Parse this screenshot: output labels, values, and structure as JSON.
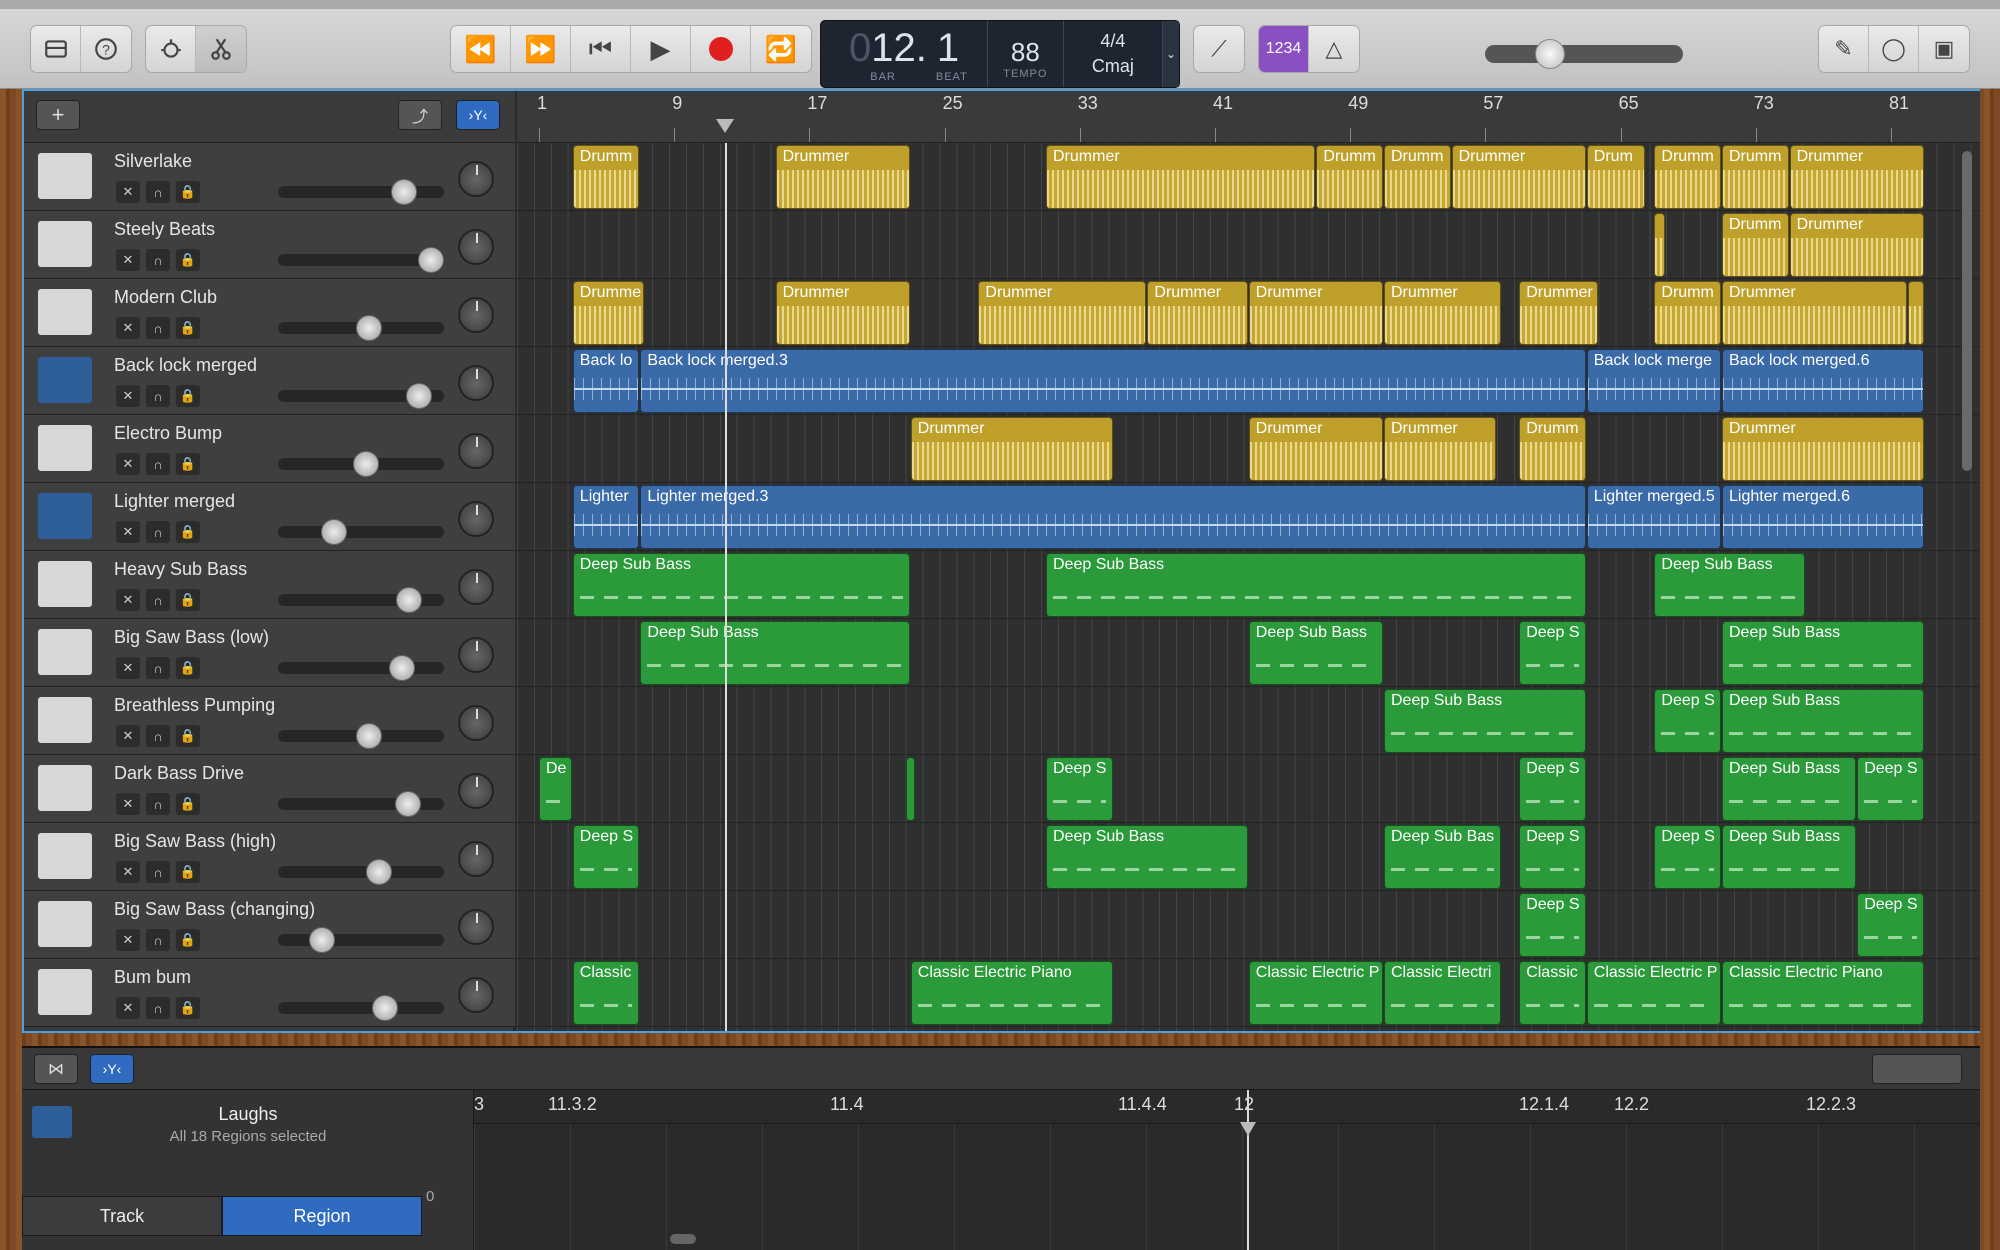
{
  "toolbar": {
    "lcd": {
      "bar": "12.",
      "beat": "1",
      "bar_label": "BAR",
      "beat_label": "BEAT",
      "tempo": "88",
      "tempo_label": "TEMPO",
      "signature": "4/4",
      "key": "Cmaj",
      "lead": "0"
    },
    "count_in_label": "1234",
    "colors": {
      "accent": "#8a4fc0",
      "record": "#e02020"
    }
  },
  "ruler": {
    "bars": [
      "1",
      "9",
      "17",
      "25",
      "33",
      "41",
      "49",
      "57",
      "65",
      "73",
      "81"
    ]
  },
  "tracks": [
    {
      "name": "Silverlake",
      "icon": "drum-machine-icon"
    },
    {
      "name": "Steely Beats",
      "icon": "drum-machine-icon"
    },
    {
      "name": "Modern Club",
      "icon": "drum-machine-icon"
    },
    {
      "name": "Back lock merged",
      "icon": "waveform-icon"
    },
    {
      "name": "Electro Bump",
      "icon": "drum-machine-icon"
    },
    {
      "name": "Lighter merged",
      "icon": "waveform-icon"
    },
    {
      "name": "Heavy Sub Bass",
      "icon": "keyboard-stand-icon"
    },
    {
      "name": "Big Saw Bass (low)",
      "icon": "synth-icon"
    },
    {
      "name": "Breathless Pumping",
      "icon": "keyboard-stand-icon"
    },
    {
      "name": "Dark Bass Drive",
      "icon": "keyboard-stand-icon"
    },
    {
      "name": "Big Saw Bass (high)",
      "icon": "synth-icon"
    },
    {
      "name": "Big Saw Bass (changing)",
      "icon": "synth-icon"
    },
    {
      "name": "Bum bum",
      "icon": "keyboard-stand-icon"
    }
  ],
  "regions": [
    [
      {
        "t": "drum",
        "s": 3,
        "e": 7,
        "l": "Drumm"
      },
      {
        "t": "drum",
        "s": 15,
        "e": 23,
        "l": "Drummer"
      },
      {
        "t": "drum",
        "s": 31,
        "e": 47,
        "l": "Drummer"
      },
      {
        "t": "drum",
        "s": 47,
        "e": 51,
        "l": "Drumm"
      },
      {
        "t": "drum",
        "s": 51,
        "e": 55,
        "l": "Drumm"
      },
      {
        "t": "drum",
        "s": 55,
        "e": 63,
        "l": "Drummer"
      },
      {
        "t": "drum",
        "s": 63,
        "e": 66.5,
        "l": "Drum"
      },
      {
        "t": "drum",
        "s": 67,
        "e": 71,
        "l": "Drumm"
      },
      {
        "t": "drum",
        "s": 71,
        "e": 75,
        "l": "Drumm"
      },
      {
        "t": "drum",
        "s": 75,
        "e": 83,
        "l": "Drummer"
      }
    ],
    [
      {
        "t": "drum",
        "s": 67,
        "e": 67.7,
        "l": ""
      },
      {
        "t": "drum",
        "s": 71,
        "e": 75,
        "l": "Drumm"
      },
      {
        "t": "drum",
        "s": 75,
        "e": 83,
        "l": "Drummer"
      }
    ],
    [
      {
        "t": "drum",
        "s": 3,
        "e": 7.3,
        "l": "Drumme"
      },
      {
        "t": "drum",
        "s": 15,
        "e": 23,
        "l": "Drummer"
      },
      {
        "t": "drum",
        "s": 27,
        "e": 37,
        "l": "Drummer"
      },
      {
        "t": "drum",
        "s": 37,
        "e": 43,
        "l": "Drummer"
      },
      {
        "t": "drum",
        "s": 43,
        "e": 51,
        "l": "Drummer"
      },
      {
        "t": "drum",
        "s": 51,
        "e": 58,
        "l": "Drummer"
      },
      {
        "t": "drum",
        "s": 59,
        "e": 63.7,
        "l": "Drummer"
      },
      {
        "t": "drum",
        "s": 67,
        "e": 71,
        "l": "Drumm"
      },
      {
        "t": "drum",
        "s": 71,
        "e": 82,
        "l": "Drummer"
      },
      {
        "t": "drum",
        "s": 82,
        "e": 83,
        "l": ""
      }
    ],
    [
      {
        "t": "audio",
        "s": 3,
        "e": 7,
        "l": "Back lo"
      },
      {
        "t": "audio",
        "s": 7,
        "e": 63,
        "l": "Back lock merged.3"
      },
      {
        "t": "audio",
        "s": 63,
        "e": 71,
        "l": "Back lock merge"
      },
      {
        "t": "audio",
        "s": 71,
        "e": 83,
        "l": "Back lock merged.6"
      }
    ],
    [
      {
        "t": "drum",
        "s": 23,
        "e": 35,
        "l": "Drummer"
      },
      {
        "t": "drum",
        "s": 43,
        "e": 51,
        "l": "Drummer"
      },
      {
        "t": "drum",
        "s": 51,
        "e": 57.7,
        "l": "Drummer"
      },
      {
        "t": "drum",
        "s": 59,
        "e": 63,
        "l": "Drumm"
      },
      {
        "t": "drum",
        "s": 71,
        "e": 83,
        "l": "Drummer"
      }
    ],
    [
      {
        "t": "audio",
        "s": 3,
        "e": 7,
        "l": "Lighter"
      },
      {
        "t": "audio",
        "s": 7,
        "e": 63,
        "l": "Lighter merged.3"
      },
      {
        "t": "audio",
        "s": 63,
        "e": 71,
        "l": "Lighter merged.5"
      },
      {
        "t": "audio",
        "s": 71,
        "e": 83,
        "l": "Lighter merged.6"
      }
    ],
    [
      {
        "t": "midi",
        "s": 3,
        "e": 23,
        "l": "Deep Sub Bass"
      },
      {
        "t": "midi",
        "s": 31,
        "e": 63,
        "l": "Deep Sub Bass"
      },
      {
        "t": "midi",
        "s": 67,
        "e": 76,
        "l": "Deep Sub Bass"
      }
    ],
    [
      {
        "t": "midi",
        "s": 7,
        "e": 23,
        "l": "Deep Sub Bass"
      },
      {
        "t": "midi",
        "s": 43,
        "e": 51,
        "l": "Deep Sub Bass"
      },
      {
        "t": "midi",
        "s": 59,
        "e": 63,
        "l": "Deep S"
      },
      {
        "t": "midi",
        "s": 71,
        "e": 83,
        "l": "Deep Sub Bass"
      }
    ],
    [
      {
        "t": "midi",
        "s": 51,
        "e": 63,
        "l": "Deep Sub Bass"
      },
      {
        "t": "midi",
        "s": 67,
        "e": 71,
        "l": "Deep S"
      },
      {
        "t": "midi",
        "s": 71,
        "e": 83,
        "l": "Deep Sub Bass"
      }
    ],
    [
      {
        "t": "midi",
        "s": 1,
        "e": 3,
        "l": "De"
      },
      {
        "t": "midi",
        "s": 22.7,
        "e": 23.3,
        "l": ""
      },
      {
        "t": "midi",
        "s": 31,
        "e": 35,
        "l": "Deep S"
      },
      {
        "t": "midi",
        "s": 59,
        "e": 63,
        "l": "Deep S"
      },
      {
        "t": "midi",
        "s": 71,
        "e": 79,
        "l": "Deep Sub Bass"
      },
      {
        "t": "midi",
        "s": 79,
        "e": 83,
        "l": "Deep S"
      }
    ],
    [
      {
        "t": "midi",
        "s": 3,
        "e": 7,
        "l": "Deep S"
      },
      {
        "t": "midi",
        "s": 31,
        "e": 43,
        "l": "Deep Sub Bass"
      },
      {
        "t": "midi",
        "s": 51,
        "e": 58,
        "l": "Deep Sub Bas"
      },
      {
        "t": "midi",
        "s": 59,
        "e": 63,
        "l": "Deep S"
      },
      {
        "t": "midi",
        "s": 67,
        "e": 71,
        "l": "Deep S"
      },
      {
        "t": "midi",
        "s": 71,
        "e": 79,
        "l": "Deep Sub Bass"
      }
    ],
    [
      {
        "t": "midi",
        "s": 59,
        "e": 63,
        "l": "Deep S"
      },
      {
        "t": "midi",
        "s": 79,
        "e": 83,
        "l": "Deep S"
      }
    ],
    [
      {
        "t": "midi",
        "s": 3,
        "e": 7,
        "l": "Classic"
      },
      {
        "t": "midi",
        "s": 23,
        "e": 35,
        "l": "Classic Electric Piano"
      },
      {
        "t": "midi",
        "s": 43,
        "e": 51,
        "l": "Classic Electric P"
      },
      {
        "t": "midi",
        "s": 51,
        "e": 58,
        "l": "Classic Electri"
      },
      {
        "t": "midi",
        "s": 59,
        "e": 63,
        "l": "Classic"
      },
      {
        "t": "midi",
        "s": 63,
        "e": 71,
        "l": "Classic Electric P"
      },
      {
        "t": "midi",
        "s": 71,
        "e": 83,
        "l": "Classic Electric Piano"
      }
    ]
  ],
  "playhead_bar": 12,
  "editor": {
    "track_name": "Laughs",
    "subtitle": "All 18 Regions selected",
    "tabs": [
      "Track",
      "Region"
    ],
    "selected_tab": "Region",
    "ruler_marks": [
      "3",
      "11.3.2",
      "11.4",
      "11.4.4",
      "12",
      "12.1.4",
      "12.2",
      "12.2.3"
    ],
    "zero_label": "0"
  }
}
